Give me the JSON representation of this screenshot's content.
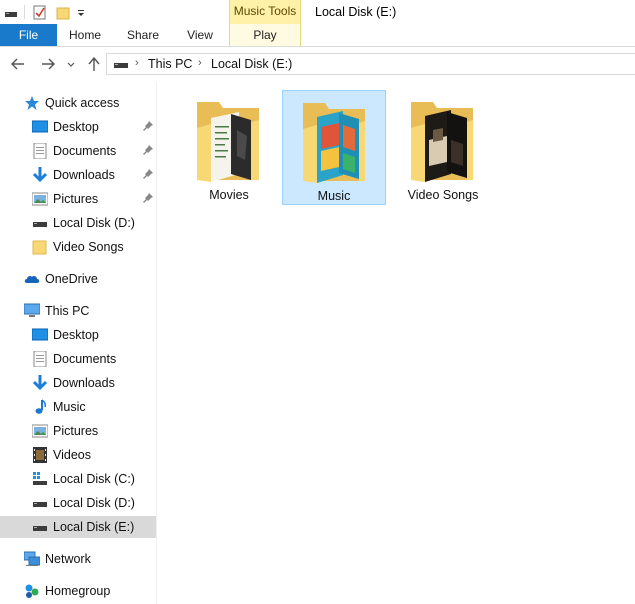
{
  "window": {
    "title": "Local Disk (E:)",
    "context_tab_group": "Music Tools"
  },
  "ribbon": {
    "tabs": [
      {
        "label": "File"
      },
      {
        "label": "Home"
      },
      {
        "label": "Share"
      },
      {
        "label": "View"
      },
      {
        "label": "Play"
      }
    ]
  },
  "navigation": {
    "breadcrumb": [
      "This PC",
      "Local Disk (E:)"
    ]
  },
  "sidebar": {
    "items": [
      {
        "label": "Quick access",
        "icon": "star-icon",
        "pinned": false
      },
      {
        "label": "Desktop",
        "icon": "desktop-icon",
        "pinned": true
      },
      {
        "label": "Documents",
        "icon": "documents-icon",
        "pinned": true
      },
      {
        "label": "Downloads",
        "icon": "downloads-icon",
        "pinned": true
      },
      {
        "label": "Pictures",
        "icon": "pictures-icon",
        "pinned": true
      },
      {
        "label": "Local Disk (D:)",
        "icon": "drive-icon",
        "pinned": false
      },
      {
        "label": "Video Songs",
        "icon": "folder-icon",
        "pinned": false
      },
      {
        "label": "OneDrive",
        "icon": "cloud-icon",
        "pinned": false
      },
      {
        "label": "This PC",
        "icon": "computer-icon",
        "pinned": false
      },
      {
        "label": "Desktop",
        "icon": "desktop-icon",
        "pinned": false
      },
      {
        "label": "Documents",
        "icon": "documents-icon",
        "pinned": false
      },
      {
        "label": "Downloads",
        "icon": "downloads-icon",
        "pinned": false
      },
      {
        "label": "Music",
        "icon": "music-icon",
        "pinned": false
      },
      {
        "label": "Pictures",
        "icon": "pictures-icon",
        "pinned": false
      },
      {
        "label": "Videos",
        "icon": "videos-icon",
        "pinned": false
      },
      {
        "label": "Local Disk (C:)",
        "icon": "windows-drive-icon",
        "pinned": false
      },
      {
        "label": "Local Disk (D:)",
        "icon": "drive-icon",
        "pinned": false
      },
      {
        "label": "Local Disk (E:)",
        "icon": "drive-icon",
        "pinned": false,
        "selected": true
      },
      {
        "label": "Network",
        "icon": "network-icon",
        "pinned": false
      },
      {
        "label": "Homegroup",
        "icon": "homegroup-icon",
        "pinned": false
      }
    ]
  },
  "content": {
    "folders": [
      {
        "name": "Movies",
        "selected": false
      },
      {
        "name": "Music",
        "selected": true
      },
      {
        "name": "Video Songs",
        "selected": false
      }
    ]
  },
  "colors": {
    "accent": "#1979ca",
    "selection": "#cce8ff",
    "selection_border": "#99d1ff",
    "sidebar_selected": "#d9d9d9",
    "context_tab": "#fff2a8",
    "folder": "#f8d775"
  }
}
